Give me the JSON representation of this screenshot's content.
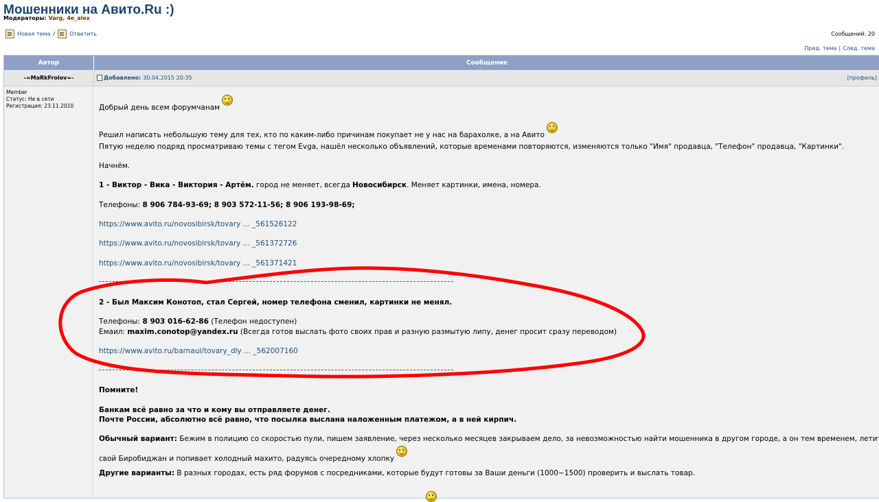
{
  "forum": {
    "title": "Мошенники на Авито.Ru :)",
    "moderators_label": "Модераторы:",
    "moderators": "Varg, 4e_alex",
    "new_topic": "Новая тема",
    "slash": "/",
    "reply": "Ответить",
    "messages_count": "Сообщений: 20",
    "prev_topic": "Пред. тема",
    "nav_sep": "|",
    "next_topic": "След. тема"
  },
  "table": {
    "col_author": "Автор",
    "col_message": "Сообщение"
  },
  "post": {
    "author": "-=MaRkFrolov=-",
    "role": "Member",
    "status": "Статус: Не в сети",
    "registered": "Регистрация: 23.11.2010",
    "added_label": "Добавлено:",
    "added_date": "30.04.2015 20:35",
    "profile_link": "[профиль]",
    "greeting": "Добрый день всем форумчанам",
    "intro": "Решил написать небольшую тему для тех, кто по каким-либо причинам покупает не у нас на барахолке, а на Авито",
    "week": "Пятую неделю подряд просматриваю темы с тегом Evga, нашёл несколько объявлений, которые временами повторяются, изменяются только \"Имя\" продавца, \"Телефон\" продавца, \"Картинки\".",
    "start": "Начнём.",
    "case1_bold": "1 - Виктор - Вика - Виктория - Артём.",
    "case1_mid": " город не меняет, всегда ",
    "case1_city": "Новосибирск",
    "case1_tail": ". Меняет картинки, имена, номера.",
    "phones1_label": "Телефоны: ",
    "phones1": "8 906 784-93-69; 8 903 572-11-56; 8 906 193-98-69;",
    "links1": [
      "https://www.avito.ru/novosibirsk/tovary ... _561526122",
      "https://www.avito.ru/novosibirsk/tovary ... _561372726",
      "https://www.avito.ru/novosibirsk/tovary ... _561371421"
    ],
    "case2": "2 - Был Максим Конотоп, стал Сергей, номер телефона сменил, картинки не менял.",
    "phones2_label": "Телефоны: ",
    "phones2": "8 903 016-62-86",
    "phones2_note": " (Телефон недоступен)",
    "email_label": "Емаил: ",
    "email": "maxim.conotop@yandex.ru",
    "email_note": " (Всегда готов выслать фото своих прав и разную размытую липу, денег просит сразу переводом)",
    "link2": "https://www.avito.ru/barnaul/tovary_dly ... _562007160",
    "remember": "Помните!",
    "banks": "Банкам всё равно за что и кому вы отправляете денег.",
    "post_office": "Почте России, абсолютно всё равно, что посылка выслана наложенным платежом, а в ней кирпич.",
    "usual_label": "Обычный вариант:",
    "usual_text": " Бежим в полицию со скоростью пули, пишем заявление, через несколько месяцев закрываем дело, за невозможностью найти мошенника в другом городе, а он тем временем, летит в",
    "usual_text2": "свой Биробиджан и попивает холодный махито, радуясь очередному хлопку",
    "other_label": "Другие варианты:",
    "other_text": " В разных городах, есть ряд форумов с посредниками, которые будут готовы за Ваши деньги (1000~1500) проверить и выслать товар."
  },
  "colors": {
    "header_bg": "#8fa0c5",
    "title": "#18456f",
    "link": "#1f4e79",
    "highlight_stroke": "#ff0000"
  }
}
